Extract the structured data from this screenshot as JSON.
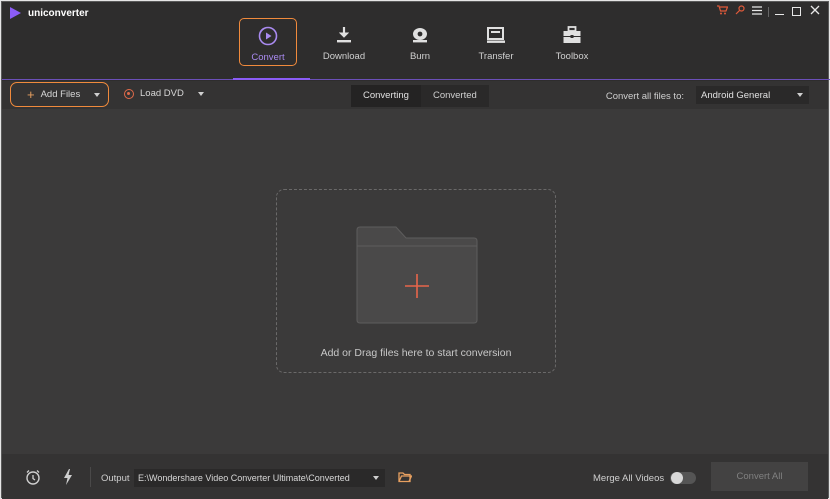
{
  "app": {
    "title": "uniconverter"
  },
  "nav": {
    "items": [
      {
        "label": "Convert",
        "icon": "convert-icon",
        "active": true
      },
      {
        "label": "Download",
        "icon": "download-icon",
        "active": false
      },
      {
        "label": "Burn",
        "icon": "burn-icon",
        "active": false
      },
      {
        "label": "Transfer",
        "icon": "transfer-icon",
        "active": false
      },
      {
        "label": "Toolbox",
        "icon": "toolbox-icon",
        "active": false
      }
    ]
  },
  "toolbar": {
    "add_files_label": "Add Files",
    "load_dvd_label": "Load DVD",
    "tabs": [
      {
        "label": "Converting",
        "active": true
      },
      {
        "label": "Converted",
        "active": false
      }
    ],
    "convert_all_label": "Convert all files to:",
    "format_value": "Android General"
  },
  "main": {
    "drop_text": "Add or Drag files here to start conversion"
  },
  "bottom": {
    "output_label": "Output",
    "output_path": "E:\\Wondershare Video Converter Ultimate\\Converted",
    "merge_label": "Merge All Videos",
    "merge_enabled": false,
    "convert_all_button": "Convert All"
  },
  "colors": {
    "accent": "#8b5cf6",
    "highlight": "#f08a3c",
    "background": "#3a3939"
  }
}
